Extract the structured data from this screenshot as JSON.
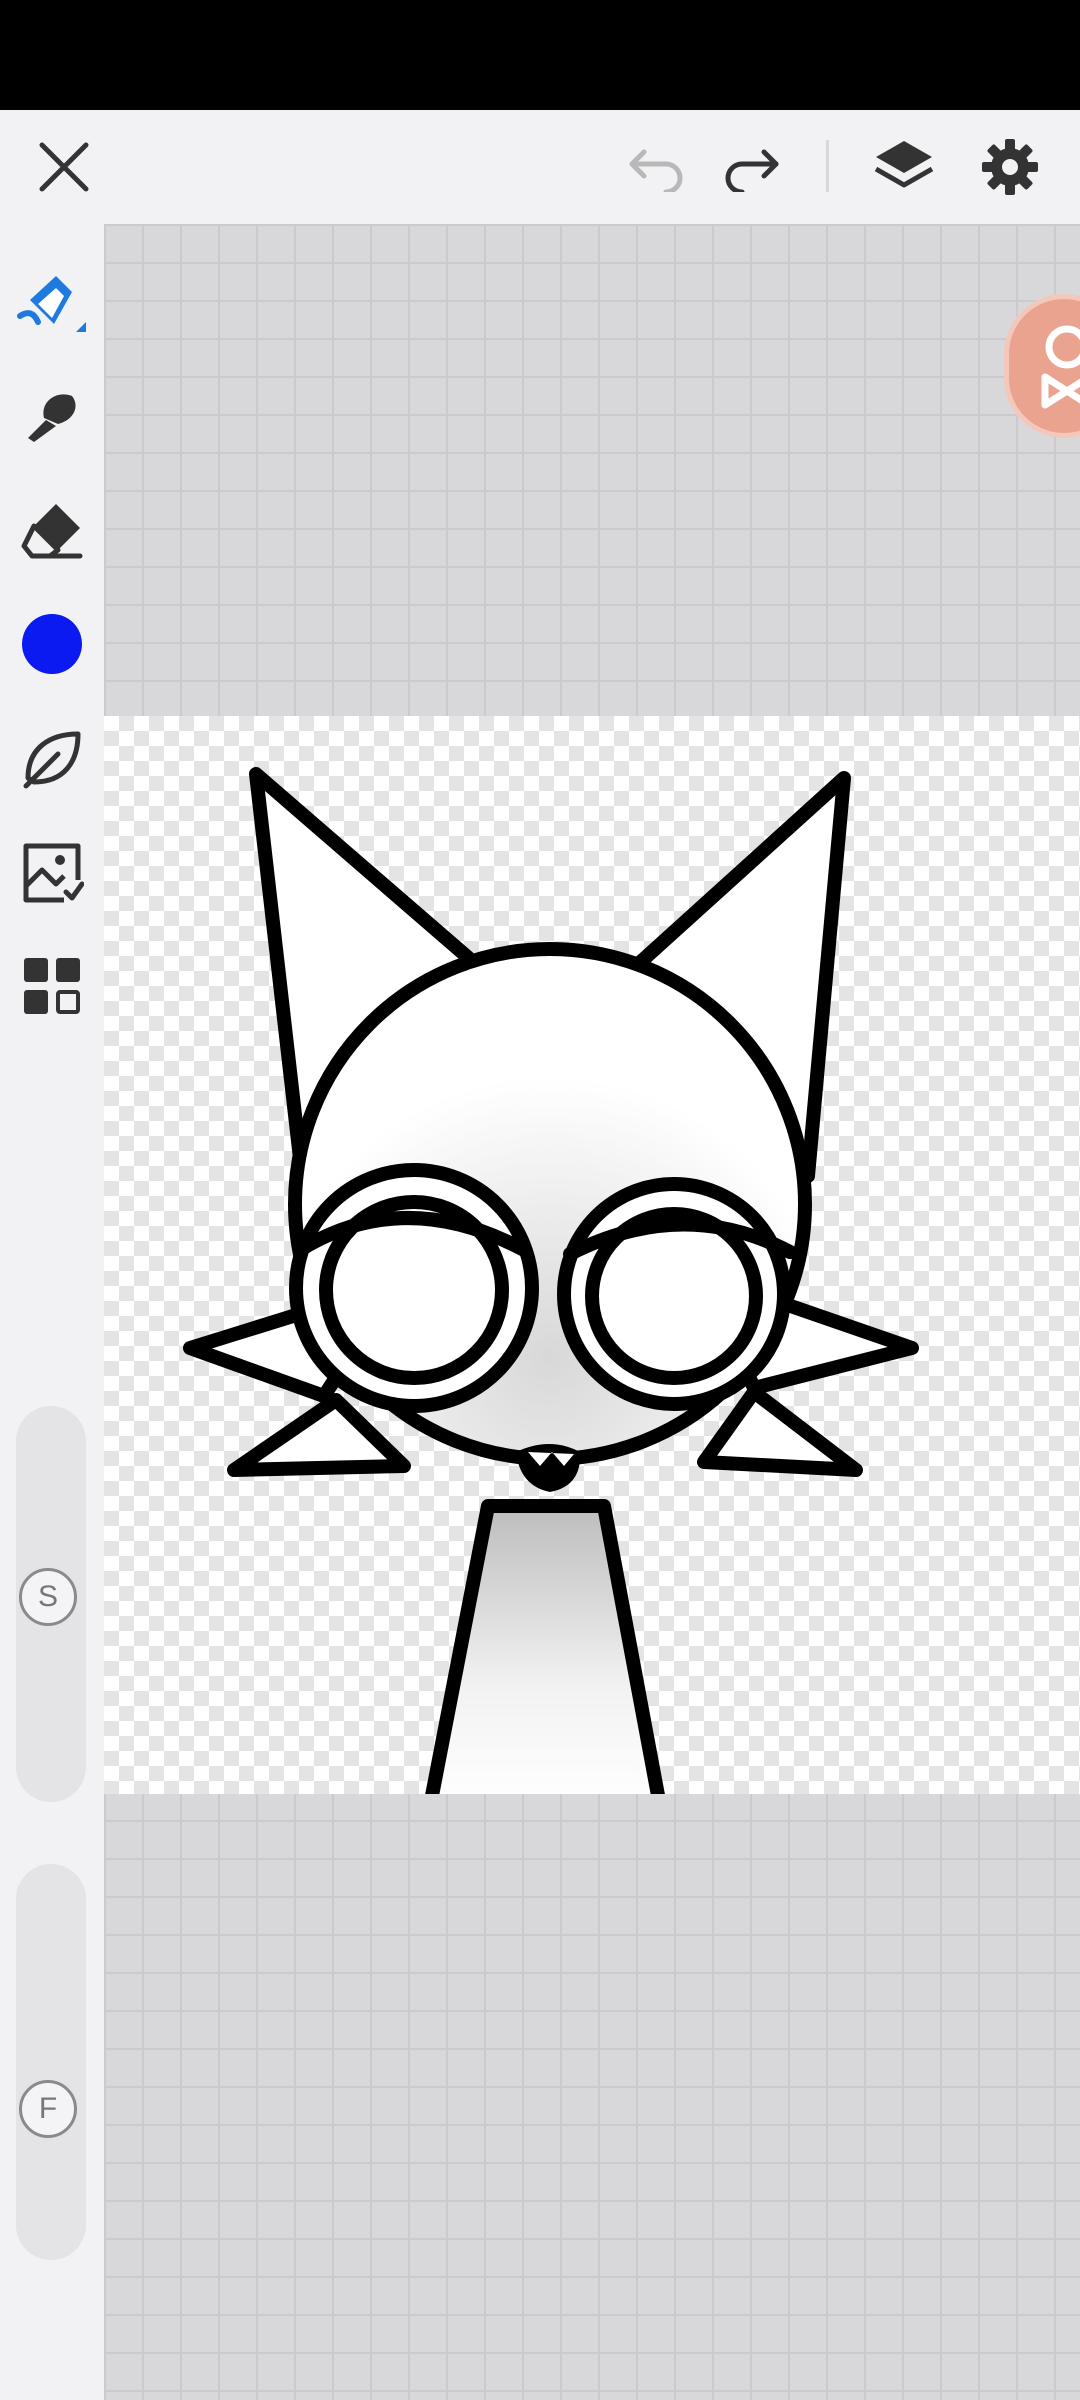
{
  "toolbar": {
    "close": "close-icon",
    "undo": "undo-icon",
    "redo": "redo-icon",
    "layers": "layers-icon",
    "settings": "gear-icon"
  },
  "tools": [
    {
      "name": "pen-tool",
      "icon": "pen-icon",
      "active": true
    },
    {
      "name": "brush-tool",
      "icon": "brush-icon",
      "active": false
    },
    {
      "name": "eraser-tool",
      "icon": "eraser-icon",
      "active": false
    },
    {
      "name": "color-picker",
      "icon": "color-swatch",
      "color": "#0a1af0"
    },
    {
      "name": "shape-tool",
      "icon": "leaf-icon",
      "active": false
    },
    {
      "name": "image-tool",
      "icon": "image-icon",
      "active": false
    },
    {
      "name": "gallery-tool",
      "icon": "grid-icon",
      "active": false
    }
  ],
  "sliders": {
    "size_label": "S",
    "flow_label": "F"
  },
  "colors": {
    "accent": "#1f7ae0",
    "current_color": "#0a1af0",
    "record_button": "#e9a38f"
  }
}
